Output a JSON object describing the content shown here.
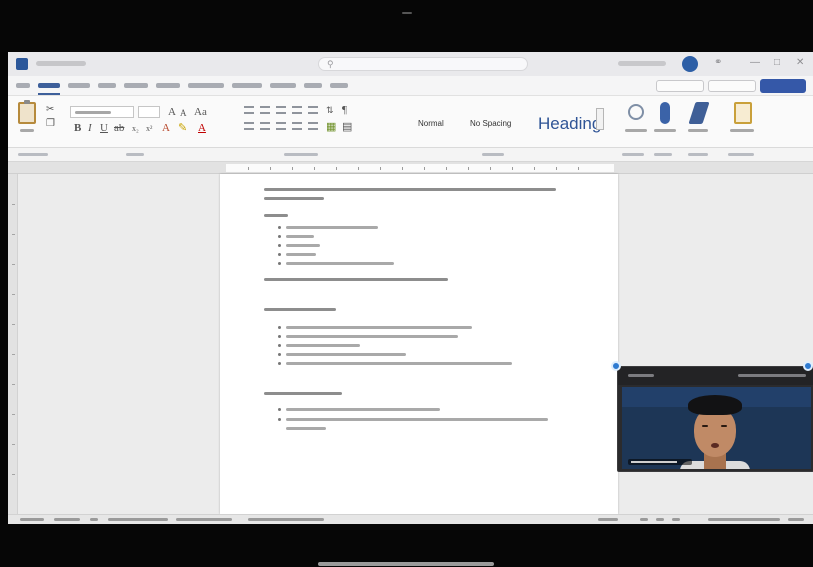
{
  "ribbon": {
    "styles": {
      "normal": "Normal",
      "no_spacing": "No Spacing",
      "heading": "Heading"
    }
  },
  "colors": {
    "ribbon_accent": "#2b579a",
    "share_button": "#3558a8",
    "heading_style": "#2f5496",
    "video_handle": "#2f7bd1"
  },
  "icons": {
    "app": "word-logo-icon",
    "search": "search-icon",
    "paste": "paste-icon",
    "bold": "bold-icon",
    "italic": "italic-icon",
    "underline": "underline-icon",
    "font_color": "font-color-icon",
    "dictate": "microphone-icon",
    "editor": "editor-pen-icon"
  }
}
